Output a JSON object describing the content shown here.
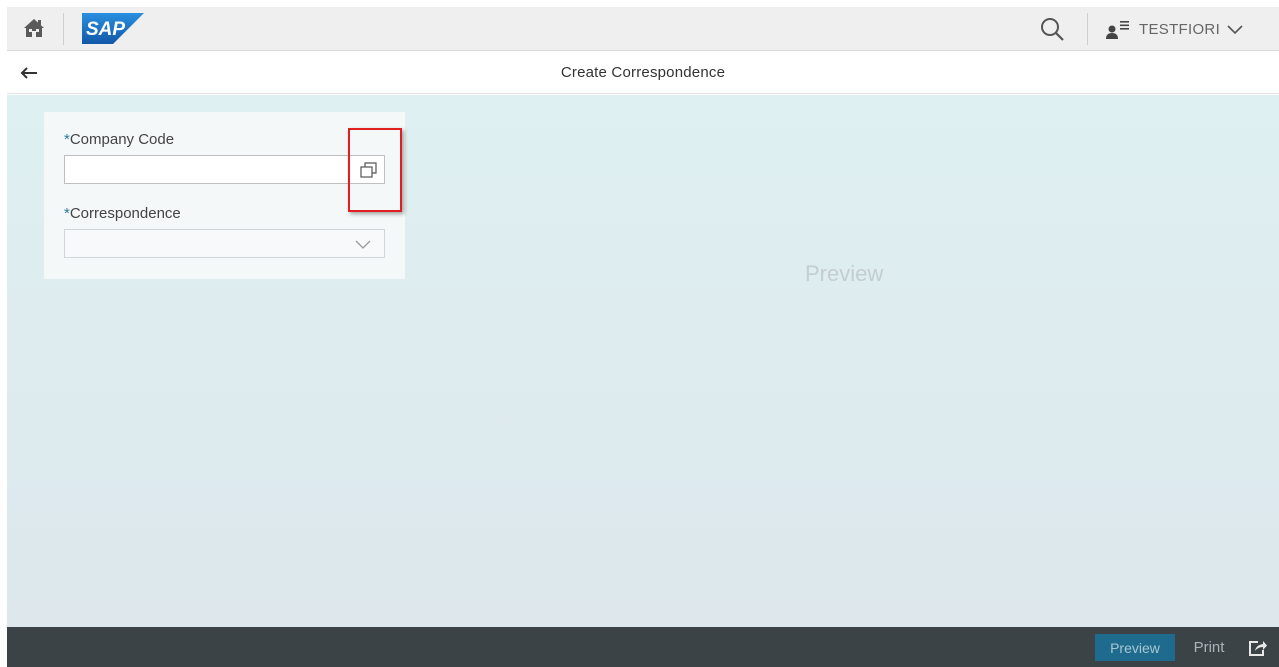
{
  "header": {
    "home_icon": "home-icon",
    "logo_text": "SAP",
    "search_icon": "search-icon",
    "user_icon": "user-menu-icon",
    "user_name": "TESTFIORI",
    "user_chevron_icon": "chevron-down-icon"
  },
  "page": {
    "back_icon": "back-arrow-icon",
    "title": "Create Correspondence"
  },
  "form": {
    "company_code": {
      "required_mark": "*",
      "label": "Company Code",
      "value": "",
      "value_help_icon": "value-help-icon"
    },
    "correspondence": {
      "required_mark": "*",
      "label": "Correspondence",
      "value": "",
      "chevron_icon": "chevron-down-icon"
    }
  },
  "preview_area": {
    "placeholder": "Preview"
  },
  "footer": {
    "preview_label": "Preview",
    "print_label": "Print",
    "share_icon": "share-icon"
  },
  "colors": {
    "shell_bar": "#efefef",
    "footer": "#3c4347",
    "accent": "#1f6b8e",
    "highlight": "#e02020",
    "sap_blue": "#1a6fbe"
  }
}
